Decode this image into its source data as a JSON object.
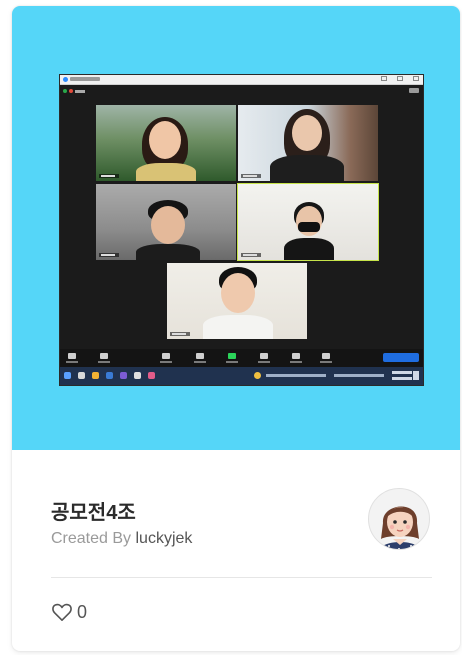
{
  "card": {
    "title": "공모전4조",
    "created_prefix": "Created By",
    "author": "luckyjek",
    "like_count": "0",
    "thumbnail": {
      "background_color": "#55d6f8",
      "content": "video-call-screenshot"
    },
    "icons": {
      "like": "heart-outline-icon",
      "avatar": "user-avatar-illustration"
    }
  }
}
